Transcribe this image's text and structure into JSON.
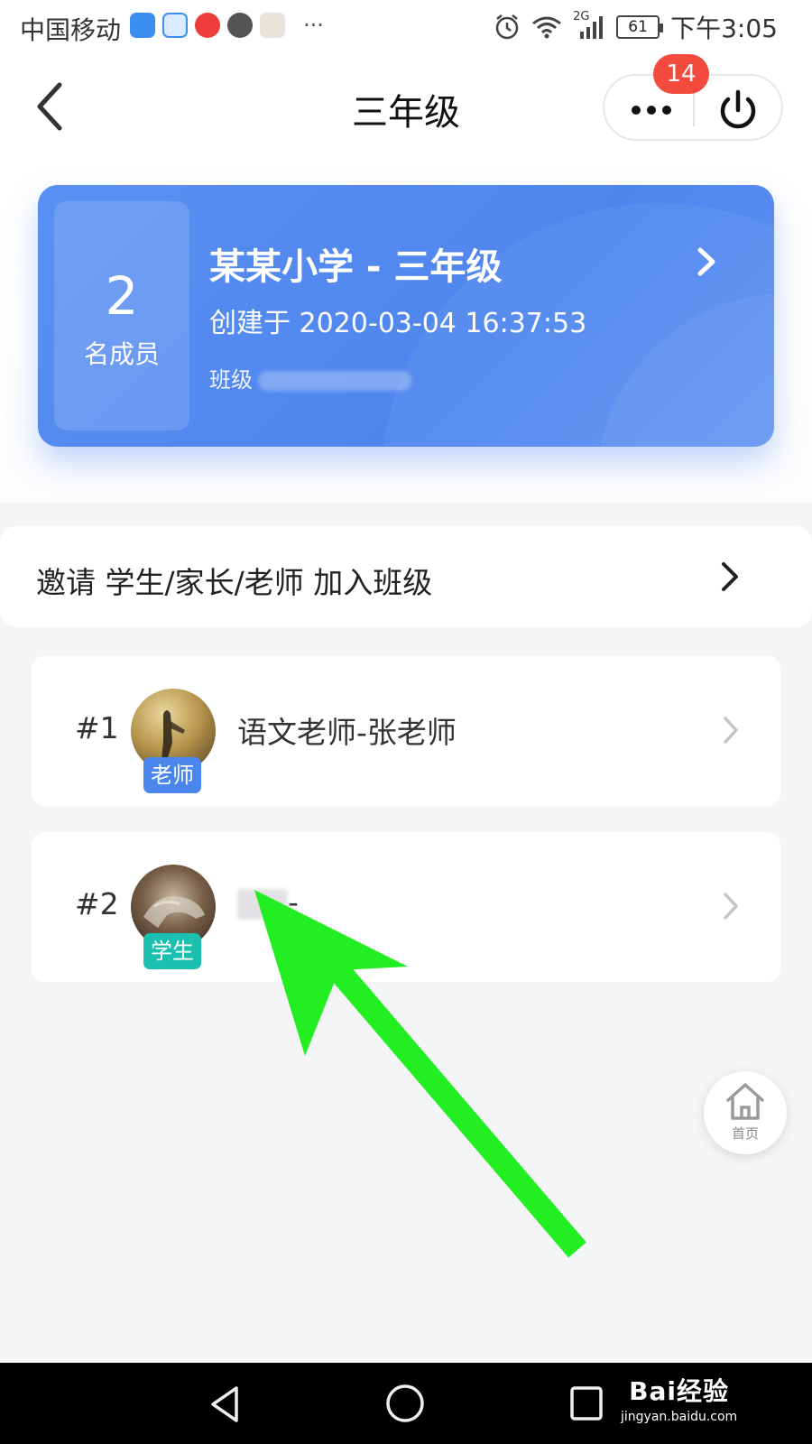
{
  "status_bar": {
    "carrier": "中国移动",
    "battery": "61",
    "time": "下午3:05",
    "network": "2G",
    "more": "···"
  },
  "header": {
    "title": "三年级",
    "badge_count": "14"
  },
  "class_card": {
    "member_count": "2",
    "member_label": "名成员",
    "school_name": "某某小学 - 三年级",
    "created": "创建于 2020-03-04 16:37:53",
    "class_code_label": "班级"
  },
  "invite": {
    "label": "邀请 学生/家长/老师 加入班级"
  },
  "members": [
    {
      "index": "#1",
      "name": "语文老师-张老师",
      "role": "老师",
      "role_color": "#4a86ee"
    },
    {
      "index": "#2",
      "name": "-",
      "role": "学生",
      "role_color": "#1cc0b0"
    }
  ],
  "home_button": {
    "label": "首页"
  },
  "watermark": {
    "main": "Bai经验",
    "sub": "jingyan.baidu.com"
  },
  "colors": {
    "accent": "#4f86ee",
    "badge": "#f24b3d",
    "annotation_arrow": "#22ee22"
  }
}
